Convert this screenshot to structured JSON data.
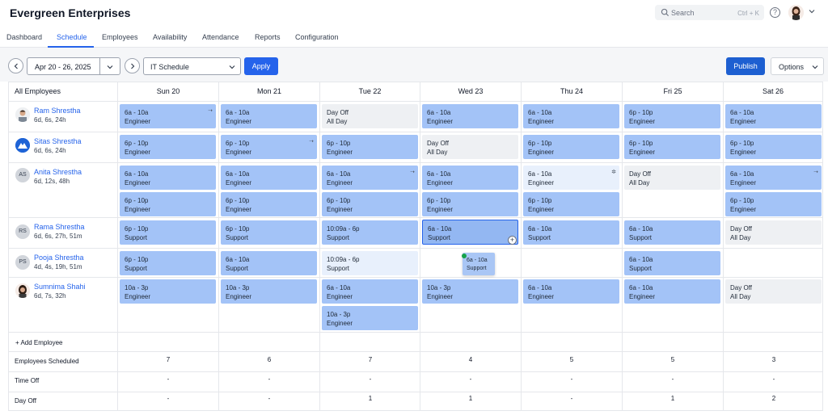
{
  "app": {
    "title": "Evergreen Enterprises"
  },
  "search": {
    "placeholder": "Search",
    "shortcut": "Ctrl + K"
  },
  "help_label": "?",
  "nav": {
    "tabs": [
      "Dashboard",
      "Schedule",
      "Employees",
      "Availability",
      "Attendance",
      "Reports",
      "Configuration"
    ],
    "active": "Schedule"
  },
  "toolbar": {
    "date_range": "Apr 20 - 26, 2025",
    "schedule_select": "IT Schedule",
    "apply_label": "Apply",
    "publish_label": "Publish",
    "options_label": "Options"
  },
  "grid": {
    "employees_header": "All Employees",
    "days": [
      "Sun 20",
      "Mon 21",
      "Tue 22",
      "Wed 23",
      "Thu 24",
      "Fri 25",
      "Sat 26"
    ],
    "employees": [
      {
        "name": "Ram Shrestha",
        "meta": "6d, 6s, 24h",
        "avatar": "photo"
      },
      {
        "name": "Sitas Shrestha",
        "meta": "6d, 6s, 24h",
        "avatar": "logo"
      },
      {
        "name": "Anita Shrestha",
        "meta": "6d, 12s, 48h",
        "avatar": "AS"
      },
      {
        "name": "Rama Shrestha",
        "meta": "6d, 6s, 27h, 51m",
        "avatar": "RS"
      },
      {
        "name": "Pooja Shrestha",
        "meta": "4d, 4s, 19h, 51m",
        "avatar": "PS"
      },
      {
        "name": "Sumnima Shahi",
        "meta": "6d, 7s, 32h",
        "avatar": "photo"
      }
    ],
    "shift_labels": {
      "morning": "6a - 10a",
      "evening": "6p - 10p",
      "midday": "10a - 3p",
      "late": "10:09a - 6p",
      "day_off": "Day Off",
      "all_day": "All Day",
      "engineer": "Engineer",
      "support": "Support"
    },
    "dragged_shift": {
      "time": "6a - 10a",
      "role": "Support"
    },
    "add_employee_label": "+ Add Employee"
  },
  "summary": {
    "rows": [
      {
        "label": "Employees Scheduled",
        "values": [
          "7",
          "6",
          "7",
          "4",
          "5",
          "5",
          "3"
        ]
      },
      {
        "label": "Time Off",
        "values": [
          "-",
          "-",
          "-",
          "-",
          "-",
          "-",
          "-"
        ]
      },
      {
        "label": "Day Off",
        "values": [
          "-",
          "-",
          "1",
          "1",
          "-",
          "1",
          "2"
        ]
      }
    ]
  },
  "colors": {
    "accent": "#2563eb",
    "shift": "#a3c3f7",
    "day_off": "#eef0f3"
  }
}
